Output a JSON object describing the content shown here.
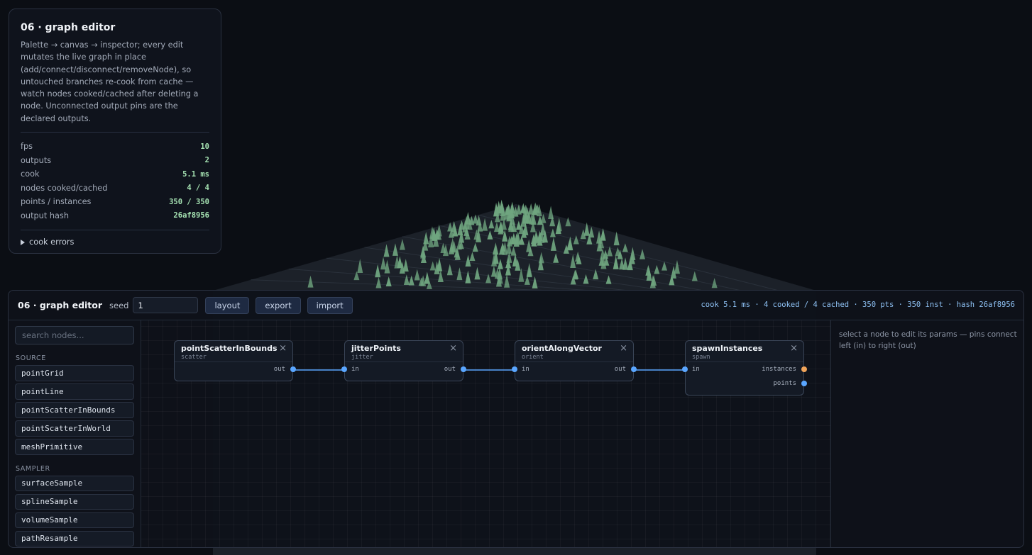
{
  "info": {
    "title": "06 · graph editor",
    "description": "Palette → canvas → inspector; every edit mutates the live graph in place (add/connect/disconnect/removeNode), so untouched branches re-cook from cache — watch nodes cooked/cached after deleting a node. Unconnected output pins are the declared outputs.",
    "stats": [
      {
        "label": "fps",
        "value": "10"
      },
      {
        "label": "outputs",
        "value": "2"
      },
      {
        "label": "cook",
        "value": "5.1 ms"
      },
      {
        "label": "nodes cooked/cached",
        "value": "4 / 4"
      },
      {
        "label": "points / instances",
        "value": "350 / 350"
      },
      {
        "label": "output hash",
        "value": "26af8956"
      }
    ],
    "errors_label": "cook errors"
  },
  "editor": {
    "title": "06 · graph editor",
    "seed_label": "seed",
    "seed_value": "1",
    "buttons": {
      "layout": "layout",
      "export": "export",
      "import": "import"
    },
    "summary": "cook 5.1 ms · 4 cooked / 4 cached · 350 pts · 350 inst · hash 26af8956"
  },
  "palette": {
    "search_placeholder": "search nodes...",
    "categories": [
      {
        "name": "SOURCE",
        "items": [
          "pointGrid",
          "pointLine",
          "pointScatterInBounds",
          "pointScatterInWorld",
          "meshPrimitive"
        ]
      },
      {
        "name": "SAMPLER",
        "items": [
          "surfaceSample",
          "splineSample",
          "volumeSample",
          "pathResample"
        ]
      }
    ]
  },
  "nodes": [
    {
      "title": "pointScatterInBounds",
      "type": "scatter",
      "inputs": [],
      "outputs": [
        "out"
      ]
    },
    {
      "title": "jitterPoints",
      "type": "jitter",
      "inputs": [
        "in"
      ],
      "outputs": [
        "out"
      ]
    },
    {
      "title": "orientAlongVector",
      "type": "orient",
      "inputs": [
        "in"
      ],
      "outputs": [
        "out"
      ]
    },
    {
      "title": "spawnInstances",
      "type": "spawn",
      "inputs": [
        "in"
      ],
      "outputs": [
        "instances",
        "points"
      ]
    }
  ],
  "close_glyph": "×",
  "inspector": {
    "hint": "select a node to edit its params — pins connect left (in) to right (out)"
  },
  "colors": {
    "accent": "#5aa6ff",
    "output_pin": "#f0a45a",
    "stat_value": "#a6e3b3",
    "tree": "#6fa57f"
  }
}
